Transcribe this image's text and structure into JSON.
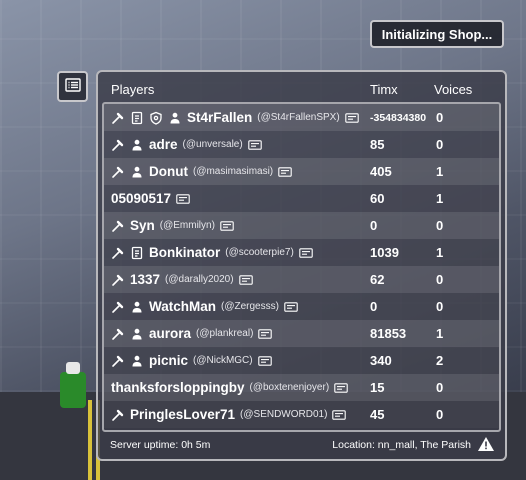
{
  "shop_button": {
    "label": "Initializing Shop..."
  },
  "list_toggle": {
    "icon": "list-icon"
  },
  "header": {
    "players": "Players",
    "timx": "Timx",
    "voices": "Voices"
  },
  "rows": [
    {
      "icons": [
        "hammer-icon",
        "document-icon",
        "shield-icon",
        "person-icon"
      ],
      "display": "St4rFallen",
      "username": "(@St4rFallenSPX)",
      "timx": "-354834380",
      "voices": "0"
    },
    {
      "icons": [
        "hammer-icon",
        "person-icon"
      ],
      "display": "adre",
      "username": "(@unversale)",
      "timx": "85",
      "voices": "0"
    },
    {
      "icons": [
        "hammer-icon",
        "person-icon"
      ],
      "display": "Donut",
      "username": "(@masimasimasi)",
      "timx": "405",
      "voices": "1"
    },
    {
      "icons": [],
      "display": "05090517",
      "username": "",
      "timx": "60",
      "voices": "1"
    },
    {
      "icons": [
        "hammer-icon"
      ],
      "display": "Syn",
      "username": "(@Emmilyn)",
      "timx": "0",
      "voices": "0"
    },
    {
      "icons": [
        "hammer-icon",
        "document-icon"
      ],
      "display": "Bonkinator",
      "username": "(@scooterpie7)",
      "timx": "1039",
      "voices": "1"
    },
    {
      "icons": [
        "hammer-icon"
      ],
      "display": "1337",
      "username": "(@darally2020)",
      "timx": "62",
      "voices": "0"
    },
    {
      "icons": [
        "hammer-icon",
        "person-icon"
      ],
      "display": "WatchMan",
      "username": "(@Zergesss)",
      "timx": "0",
      "voices": "0"
    },
    {
      "icons": [
        "hammer-icon",
        "person-icon"
      ],
      "display": "aurora",
      "username": "(@plankreal)",
      "timx": "81853",
      "voices": "1"
    },
    {
      "icons": [
        "hammer-icon",
        "person-icon"
      ],
      "display": "picnic",
      "username": "(@NickMGC)",
      "timx": "340",
      "voices": "2"
    },
    {
      "icons": [],
      "display": "thanksforsloppingby",
      "username": "(@boxtenenjoyer)",
      "timx": "15",
      "voices": "0"
    },
    {
      "icons": [
        "hammer-icon"
      ],
      "display": "PringlesLover71",
      "username": "(@SENDWORD01)",
      "timx": "45",
      "voices": "0"
    }
  ],
  "footer": {
    "uptime": "Server uptime: 0h 5m",
    "location": "Location: nn_mall, The Parish",
    "warning_icon": "warning-icon"
  },
  "colors": {
    "panel_bg": "#3a3c48",
    "border": "#b8b8bc",
    "road_line": "#d8c23a"
  }
}
